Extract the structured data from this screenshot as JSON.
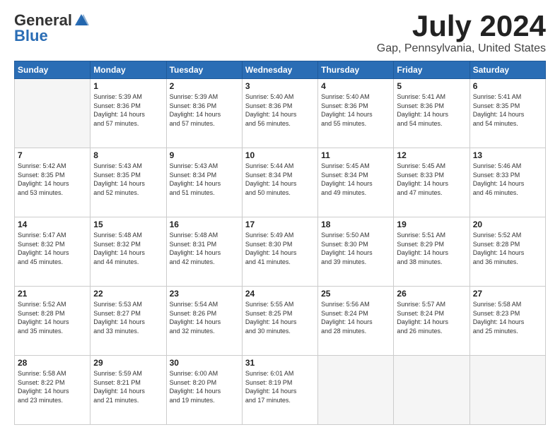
{
  "header": {
    "logo_general": "General",
    "logo_blue": "Blue",
    "title": "July 2024",
    "subtitle": "Gap, Pennsylvania, United States"
  },
  "weekdays": [
    "Sunday",
    "Monday",
    "Tuesday",
    "Wednesday",
    "Thursday",
    "Friday",
    "Saturday"
  ],
  "weeks": [
    [
      {
        "day": "",
        "content": ""
      },
      {
        "day": "1",
        "content": "Sunrise: 5:39 AM\nSunset: 8:36 PM\nDaylight: 14 hours\nand 57 minutes."
      },
      {
        "day": "2",
        "content": "Sunrise: 5:39 AM\nSunset: 8:36 PM\nDaylight: 14 hours\nand 57 minutes."
      },
      {
        "day": "3",
        "content": "Sunrise: 5:40 AM\nSunset: 8:36 PM\nDaylight: 14 hours\nand 56 minutes."
      },
      {
        "day": "4",
        "content": "Sunrise: 5:40 AM\nSunset: 8:36 PM\nDaylight: 14 hours\nand 55 minutes."
      },
      {
        "day": "5",
        "content": "Sunrise: 5:41 AM\nSunset: 8:36 PM\nDaylight: 14 hours\nand 54 minutes."
      },
      {
        "day": "6",
        "content": "Sunrise: 5:41 AM\nSunset: 8:35 PM\nDaylight: 14 hours\nand 54 minutes."
      }
    ],
    [
      {
        "day": "7",
        "content": "Sunrise: 5:42 AM\nSunset: 8:35 PM\nDaylight: 14 hours\nand 53 minutes."
      },
      {
        "day": "8",
        "content": "Sunrise: 5:43 AM\nSunset: 8:35 PM\nDaylight: 14 hours\nand 52 minutes."
      },
      {
        "day": "9",
        "content": "Sunrise: 5:43 AM\nSunset: 8:34 PM\nDaylight: 14 hours\nand 51 minutes."
      },
      {
        "day": "10",
        "content": "Sunrise: 5:44 AM\nSunset: 8:34 PM\nDaylight: 14 hours\nand 50 minutes."
      },
      {
        "day": "11",
        "content": "Sunrise: 5:45 AM\nSunset: 8:34 PM\nDaylight: 14 hours\nand 49 minutes."
      },
      {
        "day": "12",
        "content": "Sunrise: 5:45 AM\nSunset: 8:33 PM\nDaylight: 14 hours\nand 47 minutes."
      },
      {
        "day": "13",
        "content": "Sunrise: 5:46 AM\nSunset: 8:33 PM\nDaylight: 14 hours\nand 46 minutes."
      }
    ],
    [
      {
        "day": "14",
        "content": "Sunrise: 5:47 AM\nSunset: 8:32 PM\nDaylight: 14 hours\nand 45 minutes."
      },
      {
        "day": "15",
        "content": "Sunrise: 5:48 AM\nSunset: 8:32 PM\nDaylight: 14 hours\nand 44 minutes."
      },
      {
        "day": "16",
        "content": "Sunrise: 5:48 AM\nSunset: 8:31 PM\nDaylight: 14 hours\nand 42 minutes."
      },
      {
        "day": "17",
        "content": "Sunrise: 5:49 AM\nSunset: 8:30 PM\nDaylight: 14 hours\nand 41 minutes."
      },
      {
        "day": "18",
        "content": "Sunrise: 5:50 AM\nSunset: 8:30 PM\nDaylight: 14 hours\nand 39 minutes."
      },
      {
        "day": "19",
        "content": "Sunrise: 5:51 AM\nSunset: 8:29 PM\nDaylight: 14 hours\nand 38 minutes."
      },
      {
        "day": "20",
        "content": "Sunrise: 5:52 AM\nSunset: 8:28 PM\nDaylight: 14 hours\nand 36 minutes."
      }
    ],
    [
      {
        "day": "21",
        "content": "Sunrise: 5:52 AM\nSunset: 8:28 PM\nDaylight: 14 hours\nand 35 minutes."
      },
      {
        "day": "22",
        "content": "Sunrise: 5:53 AM\nSunset: 8:27 PM\nDaylight: 14 hours\nand 33 minutes."
      },
      {
        "day": "23",
        "content": "Sunrise: 5:54 AM\nSunset: 8:26 PM\nDaylight: 14 hours\nand 32 minutes."
      },
      {
        "day": "24",
        "content": "Sunrise: 5:55 AM\nSunset: 8:25 PM\nDaylight: 14 hours\nand 30 minutes."
      },
      {
        "day": "25",
        "content": "Sunrise: 5:56 AM\nSunset: 8:24 PM\nDaylight: 14 hours\nand 28 minutes."
      },
      {
        "day": "26",
        "content": "Sunrise: 5:57 AM\nSunset: 8:24 PM\nDaylight: 14 hours\nand 26 minutes."
      },
      {
        "day": "27",
        "content": "Sunrise: 5:58 AM\nSunset: 8:23 PM\nDaylight: 14 hours\nand 25 minutes."
      }
    ],
    [
      {
        "day": "28",
        "content": "Sunrise: 5:58 AM\nSunset: 8:22 PM\nDaylight: 14 hours\nand 23 minutes."
      },
      {
        "day": "29",
        "content": "Sunrise: 5:59 AM\nSunset: 8:21 PM\nDaylight: 14 hours\nand 21 minutes."
      },
      {
        "day": "30",
        "content": "Sunrise: 6:00 AM\nSunset: 8:20 PM\nDaylight: 14 hours\nand 19 minutes."
      },
      {
        "day": "31",
        "content": "Sunrise: 6:01 AM\nSunset: 8:19 PM\nDaylight: 14 hours\nand 17 minutes."
      },
      {
        "day": "",
        "content": ""
      },
      {
        "day": "",
        "content": ""
      },
      {
        "day": "",
        "content": ""
      }
    ]
  ]
}
